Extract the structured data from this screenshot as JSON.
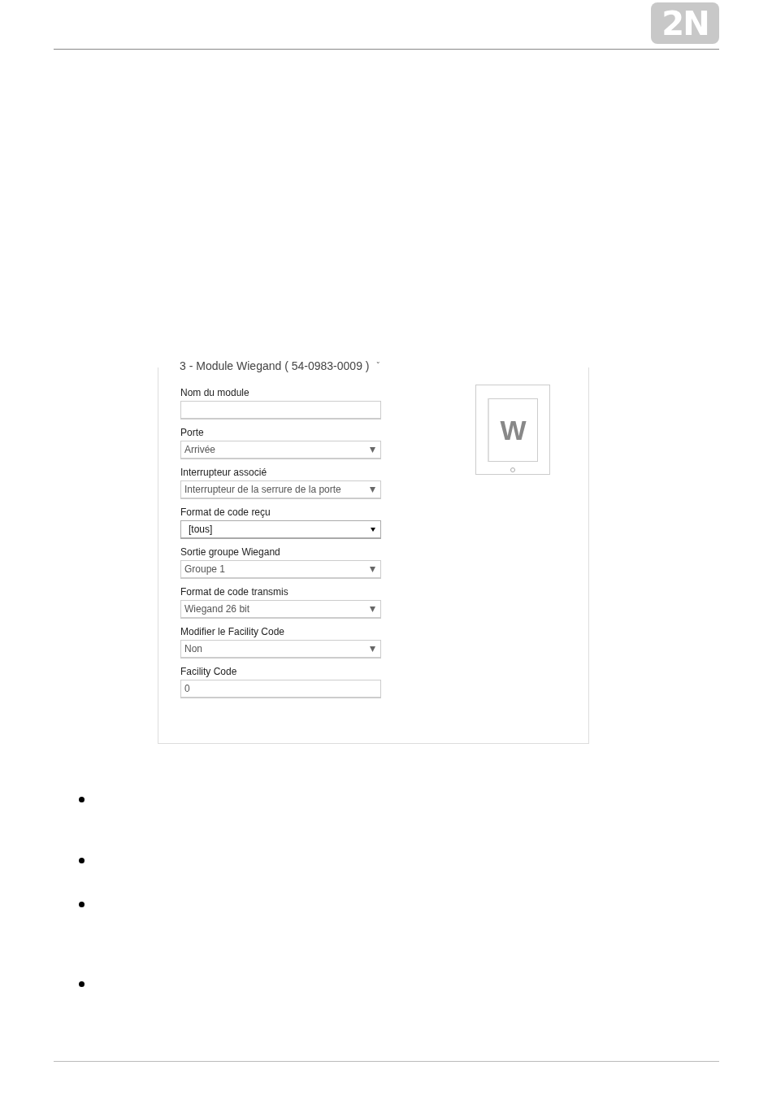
{
  "header": {
    "logo": "2N"
  },
  "module": {
    "title": "3 - Module Wiegand ( 54-0983-0009 )",
    "caret": "ˇ",
    "device_letter": "W",
    "fields": [
      {
        "label": "Nom du module",
        "kind": "text",
        "highlighted": false
      },
      {
        "label": "Porte",
        "kind": "select",
        "value": "Arrivée",
        "highlighted": false
      },
      {
        "label": "Interrupteur associé",
        "kind": "select",
        "value": "Interrupteur de la serrure de la porte",
        "highlighted": false
      },
      {
        "label": "Format de code reçu",
        "kind": "select",
        "value": "[tous]",
        "highlighted": true
      },
      {
        "label": "Sortie groupe Wiegand",
        "kind": "select",
        "value": "Groupe 1",
        "highlighted": false
      },
      {
        "label": "Format de code transmis",
        "kind": "select",
        "value": "Wiegand 26 bit",
        "highlighted": false
      },
      {
        "label": "Modifier le Facility Code",
        "kind": "select",
        "value": "Non",
        "highlighted": false
      },
      {
        "label": "Facility Code",
        "kind": "text",
        "value": "0",
        "highlighted": false
      }
    ]
  },
  "bullets": [
    {
      "kind": "bullet"
    },
    {
      "kind": "bullet"
    },
    {
      "kind": "bullet"
    },
    {
      "kind": "bullet"
    }
  ]
}
